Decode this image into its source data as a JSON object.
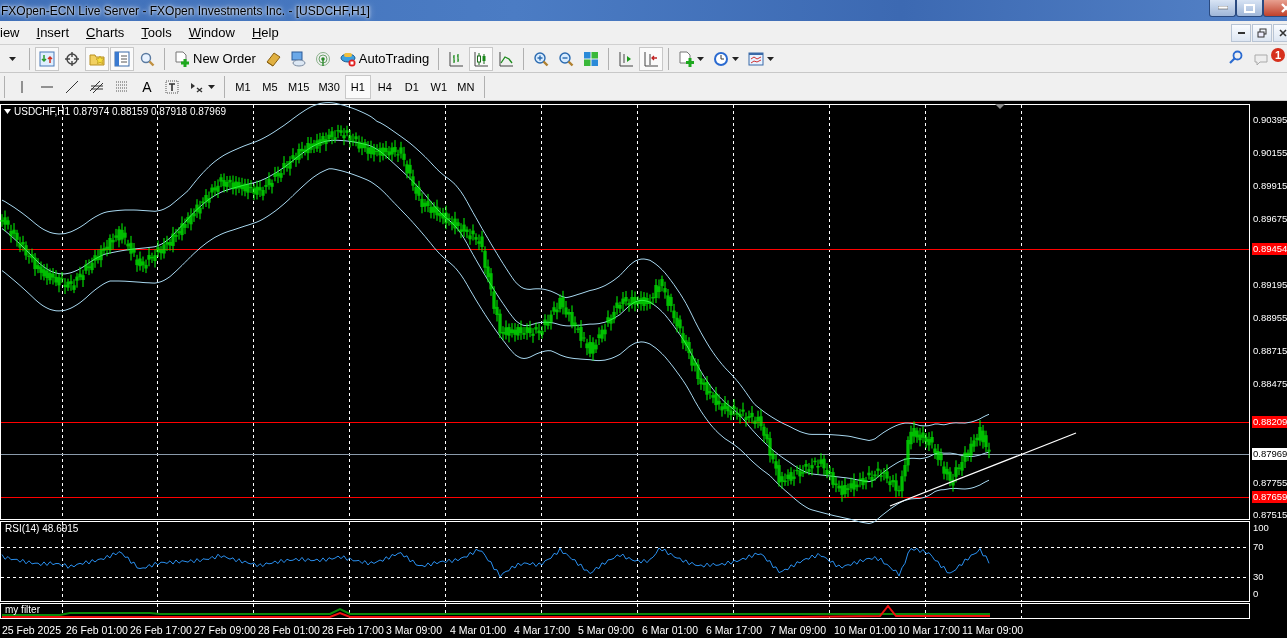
{
  "window": {
    "title": "FXOpen-ECN Live Server - FXOpen Investments Inc. - [USDCHF,H1]"
  },
  "menu": [
    {
      "label": "iew"
    },
    {
      "label": "Insert"
    },
    {
      "label": "Charts"
    },
    {
      "label": "Tools"
    },
    {
      "label": "Window"
    },
    {
      "label": "Help"
    }
  ],
  "toolbar": [
    {
      "kind": "caret"
    },
    {
      "kind": "separator"
    },
    {
      "kind": "icon",
      "pressed": true
    },
    {
      "kind": "icon",
      "pressed": false
    },
    {
      "kind": "icon",
      "pressed": true
    },
    {
      "kind": "icon",
      "pressed": true
    },
    {
      "kind": "icon",
      "pressed": false
    },
    {
      "kind": "separator"
    },
    {
      "kind": "labeled",
      "label": "New Order",
      "pressed": false
    },
    {
      "kind": "icon",
      "pressed": false
    },
    {
      "kind": "icon",
      "pressed": false
    },
    {
      "kind": "icon",
      "pressed": false
    },
    {
      "kind": "labeled",
      "label": "AutoTrading",
      "pressed": false
    },
    {
      "kind": "separator"
    },
    {
      "kind": "icon",
      "pressed": false
    },
    {
      "kind": "icon",
      "pressed": true
    },
    {
      "kind": "icon",
      "pressed": false
    },
    {
      "kind": "separator"
    },
    {
      "kind": "icon",
      "pressed": false
    },
    {
      "kind": "icon",
      "pressed": false
    },
    {
      "kind": "icon",
      "pressed": false
    },
    {
      "kind": "separator"
    },
    {
      "kind": "icon",
      "pressed": false
    },
    {
      "kind": "icon",
      "pressed": true
    },
    {
      "kind": "separator"
    },
    {
      "kind": "menu-icon",
      "pressed": false
    },
    {
      "kind": "menu-icon",
      "pressed": false
    },
    {
      "kind": "menu-icon",
      "pressed": false
    }
  ],
  "notifications": {
    "count": "1"
  },
  "drawing_tools": [
    {
      "kind": "icon"
    },
    {
      "kind": "icon"
    },
    {
      "kind": "icon"
    },
    {
      "kind": "icon"
    },
    {
      "kind": "icon"
    },
    {
      "kind": "glyph",
      "label": "A"
    },
    {
      "kind": "icon"
    },
    {
      "kind": "menu-icon"
    }
  ],
  "timeframes": [
    {
      "label": "M1",
      "selected": false
    },
    {
      "label": "M5",
      "selected": false
    },
    {
      "label": "M15",
      "selected": false
    },
    {
      "label": "M30",
      "selected": false
    },
    {
      "label": "H1",
      "selected": true
    },
    {
      "label": "H4",
      "selected": false
    },
    {
      "label": "D1",
      "selected": false
    },
    {
      "label": "W1",
      "selected": false
    },
    {
      "label": "MN",
      "selected": false
    }
  ],
  "chart": {
    "symbol": "USDCHF,H1",
    "quote": "0.87974 0.88159 0.87918 0.87969",
    "price_axis": [
      {
        "label": "0.90395",
        "kind": "tick"
      },
      {
        "label": "0.90155",
        "kind": "tick"
      },
      {
        "label": "0.89915",
        "kind": "tick"
      },
      {
        "label": "0.89675",
        "kind": "tick"
      },
      {
        "label": "0.89454",
        "kind": "level"
      },
      {
        "label": "0.89195",
        "kind": "tick"
      },
      {
        "label": "0.88955",
        "kind": "tick"
      },
      {
        "label": "0.88715",
        "kind": "tick"
      },
      {
        "label": "0.88475",
        "kind": "tick"
      },
      {
        "label": "0.88209",
        "kind": "level"
      },
      {
        "label": "0.87969",
        "kind": "current"
      },
      {
        "label": "0.87755",
        "kind": "tick"
      },
      {
        "label": "0.87659",
        "kind": "level"
      },
      {
        "label": "0.87515",
        "kind": "tick"
      }
    ],
    "rsi": {
      "label": "RSI(14) 48.6915",
      "axis": [
        "100",
        "70",
        "30",
        "0"
      ]
    },
    "filter": {
      "label": "my filter"
    },
    "time_axis": [
      "25 Feb 2025",
      "26 Feb 01:00",
      "26 Feb 17:00",
      "27 Feb 09:00",
      "28 Feb 01:00",
      "28 Feb 17:00",
      "3 Mar 09:00",
      "4 Mar 01:00",
      "4 Mar 17:00",
      "5 Mar 09:00",
      "6 Mar 01:00",
      "6 Mar 17:00",
      "7 Mar 09:00",
      "10 Mar 01:00",
      "10 Mar 17:00",
      "11 Mar 09:00"
    ]
  }
}
